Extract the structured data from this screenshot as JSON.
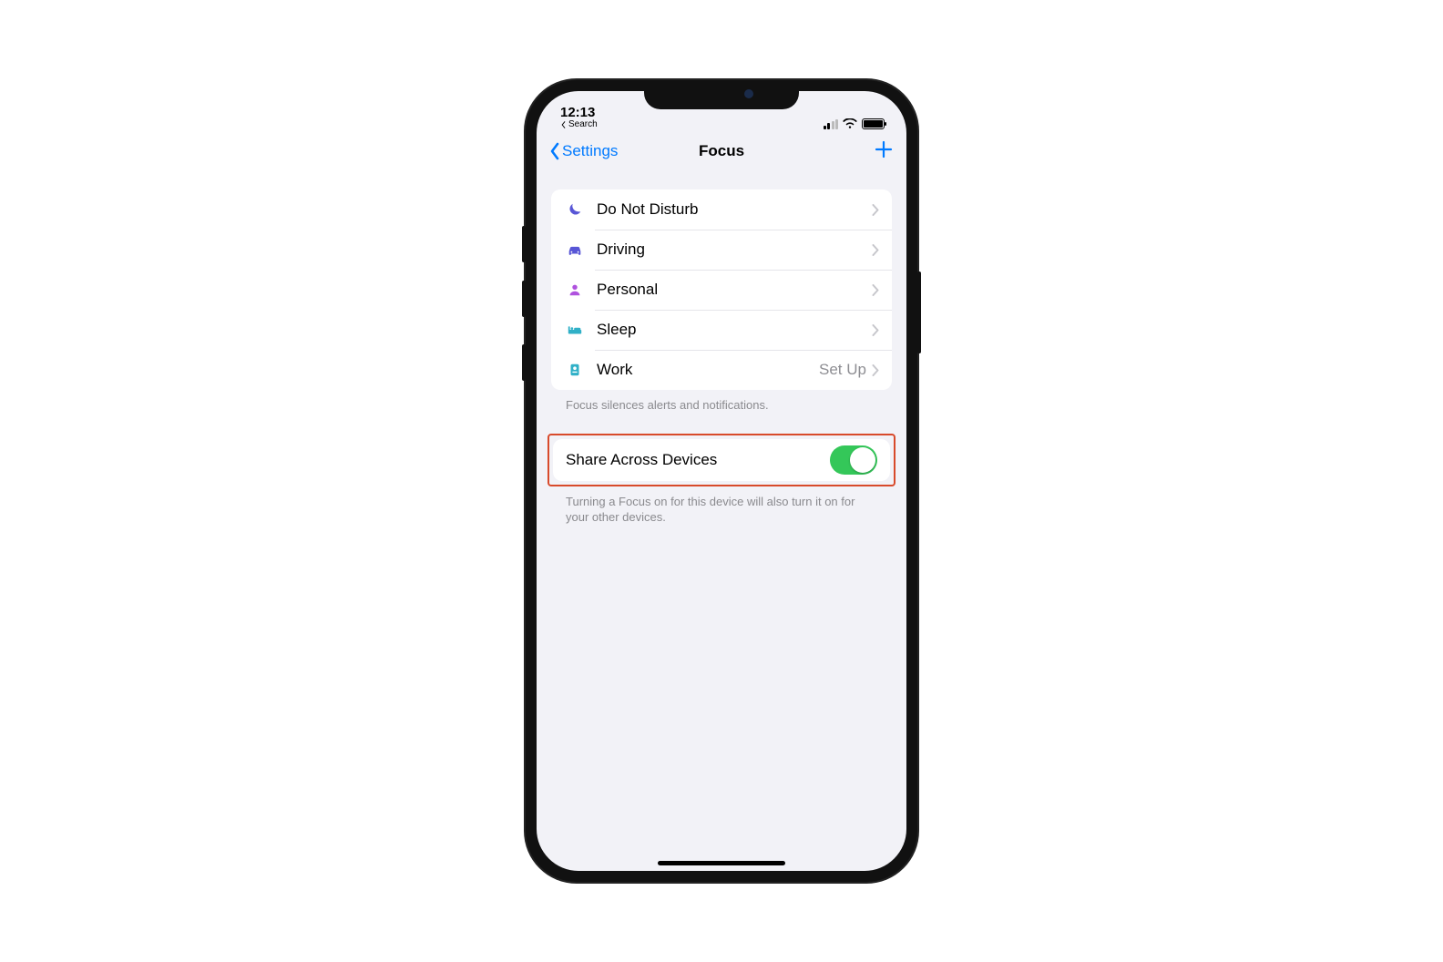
{
  "status": {
    "time": "12:13",
    "breadcrumb": "Search"
  },
  "nav": {
    "back_label": "Settings",
    "title": "Focus"
  },
  "focus_modes": [
    {
      "label": "Do Not Disturb",
      "icon": "moon",
      "color": "#5856d6",
      "detail": ""
    },
    {
      "label": "Driving",
      "icon": "car",
      "color": "#5856d6",
      "detail": ""
    },
    {
      "label": "Personal",
      "icon": "person",
      "color": "#af52de",
      "detail": ""
    },
    {
      "label": "Sleep",
      "icon": "bed",
      "color": "#30b0c7",
      "detail": ""
    },
    {
      "label": "Work",
      "icon": "badge",
      "color": "#30b0c7",
      "detail": "Set Up"
    }
  ],
  "footer1": "Focus silences alerts and notifications.",
  "share": {
    "label": "Share Across Devices",
    "enabled": true
  },
  "footer2": "Turning a Focus on for this device will also turn it on for your other devices."
}
